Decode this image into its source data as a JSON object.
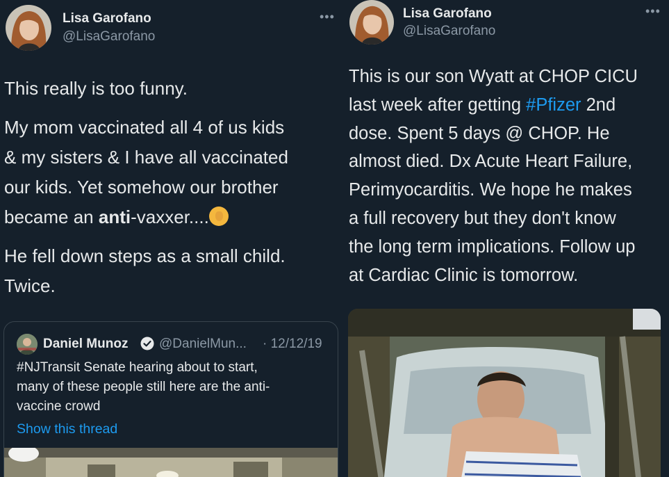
{
  "left_tweet": {
    "author_name": "Lisa Garofano",
    "author_handle": "@LisaGarofano",
    "more_icon": "•••",
    "paragraph1": "This really is too funny.",
    "para2_line1": "My mom vaccinated all 4 of us kids",
    "para2_line2": "& my sisters & I have all vaccinated",
    "para2_line3": "our kids. Yet somehow our brother",
    "para2_line4_pre": "became an ",
    "para2_line4_bold": "anti",
    "para2_line4_post": "-vaxxer....",
    "emoji_name": "facepalm-emoji",
    "para3_line1": "He fell down steps as a small child.",
    "para3_line2": "Twice.",
    "quote": {
      "author_name": "Daniel Munoz",
      "author_handle": "@DanielMun...",
      "date": "· 12/12/19",
      "text_line1": "#NJTransit Senate hearing about to start,",
      "text_line2": "many of these people still here are the anti-",
      "text_line3": "vaccine crowd",
      "show_thread": "Show this thread"
    }
  },
  "right_tweet": {
    "author_name": "Lisa Garofano",
    "author_handle": "@LisaGarofano",
    "more_icon": "•••",
    "line1": "This is our son Wyatt at CHOP CICU",
    "line2_pre": "last week after getting ",
    "line2_hashtag": "#Pfizer",
    "line2_post": " 2nd",
    "line3": "dose. Spent 5 days @ CHOP. He",
    "line4": "almost died. Dx Acute Heart Failure,",
    "line5": "Perimyocarditis. We hope he makes",
    "line6": "a full recovery but they don't know",
    "line7": "the long term implications. Follow up",
    "line8": "at Cardiac Clinic is tomorrow."
  },
  "colors": {
    "background": "#15202b",
    "text": "#e7e9ea",
    "secondary": "#8b98a5",
    "link": "#1d9bf0",
    "border": "#38444d"
  }
}
